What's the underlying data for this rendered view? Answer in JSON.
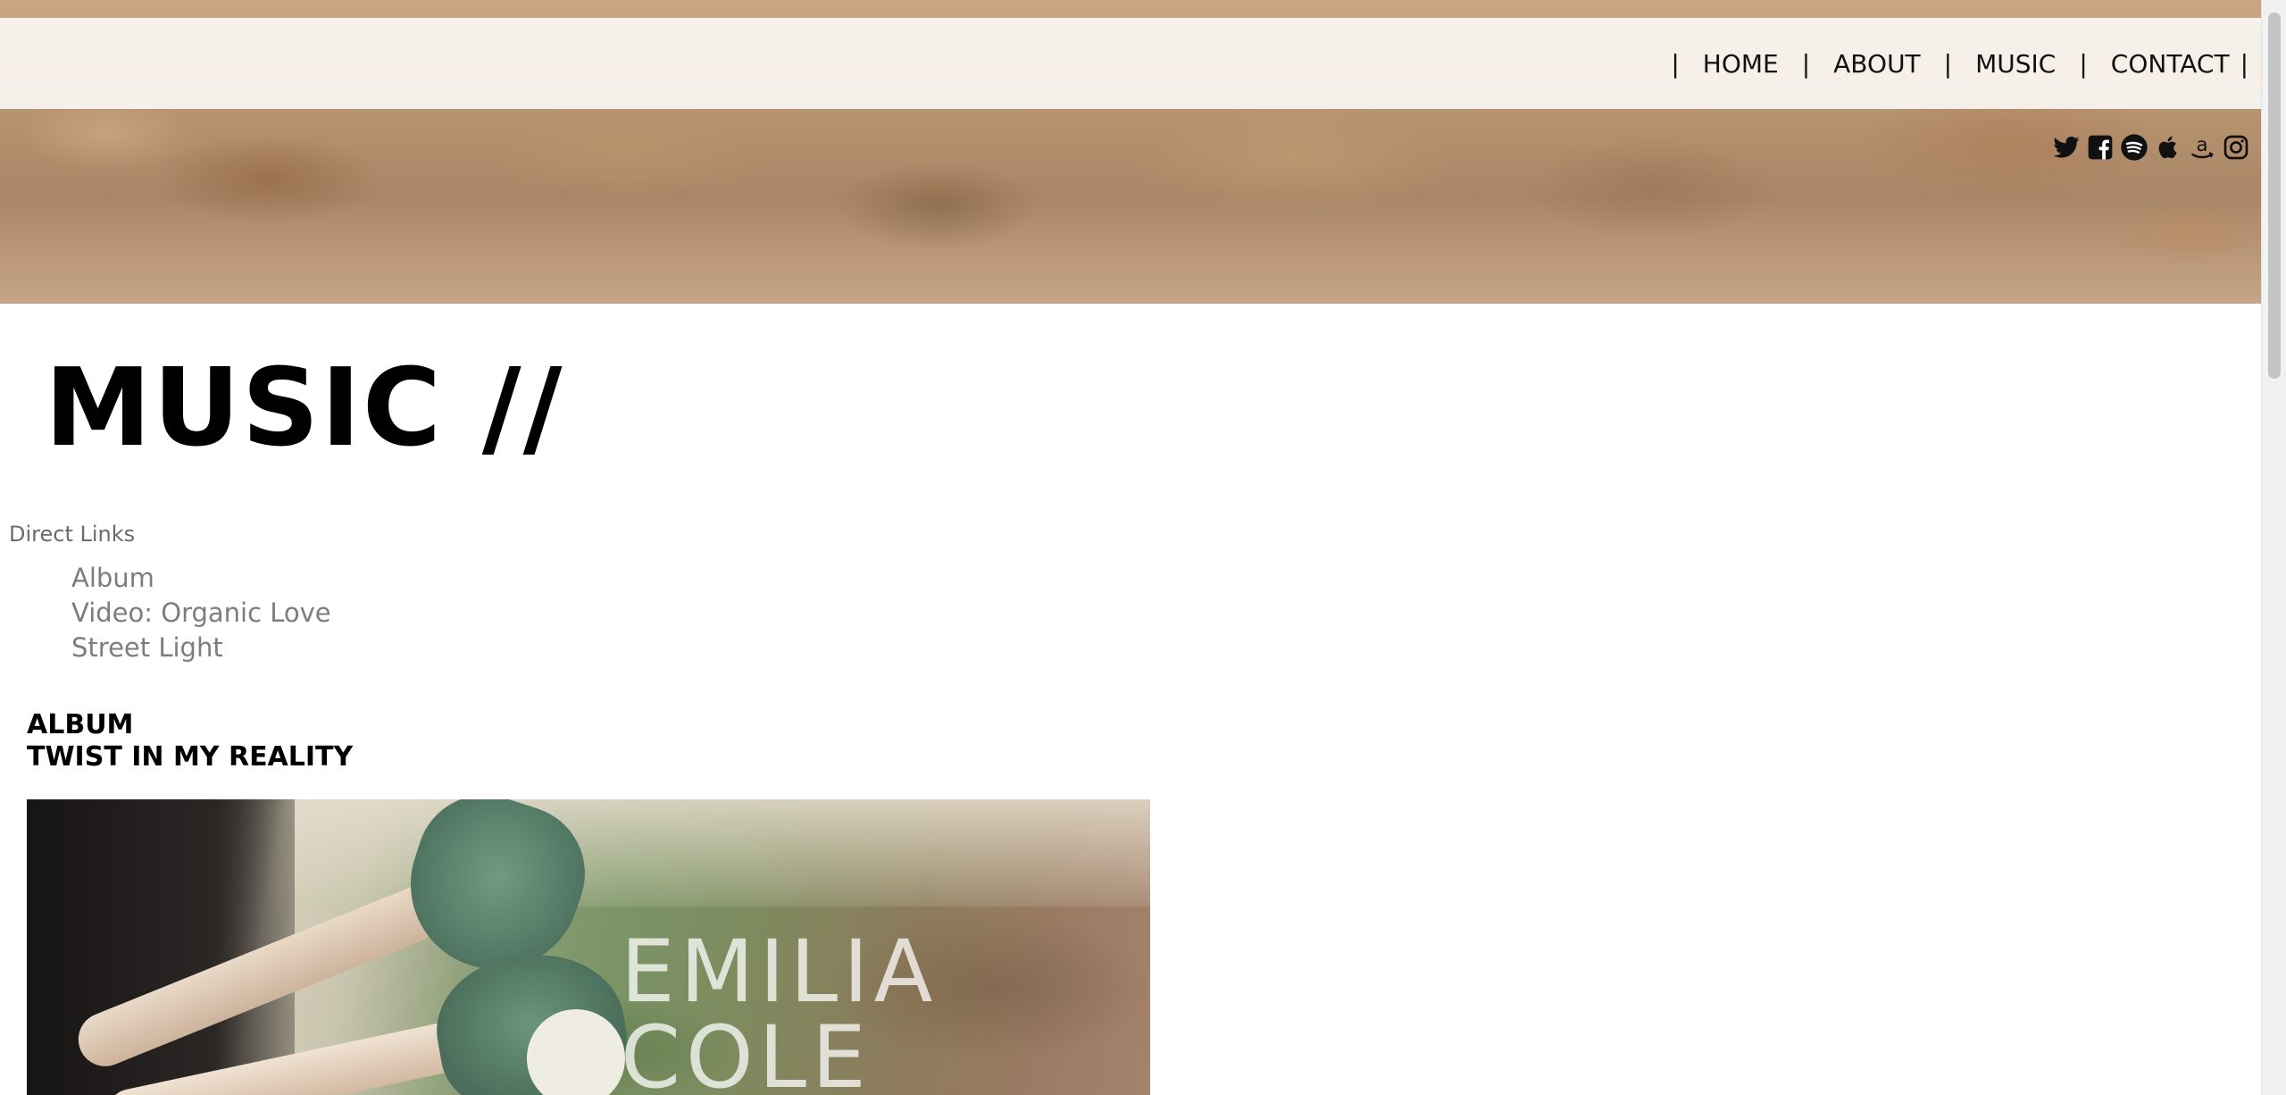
{
  "nav": {
    "items": [
      {
        "label": "HOME"
      },
      {
        "label": "ABOUT"
      },
      {
        "label": "MUSIC"
      },
      {
        "label": "CONTACT"
      }
    ],
    "separator": "|"
  },
  "social": [
    {
      "icon": "twitter-icon"
    },
    {
      "icon": "facebook-icon"
    },
    {
      "icon": "spotify-icon"
    },
    {
      "icon": "apple-icon"
    },
    {
      "icon": "amazon-icon"
    },
    {
      "icon": "instagram-icon"
    }
  ],
  "page": {
    "title": "MUSIC //"
  },
  "direct_links": {
    "title": "Direct Links",
    "items": [
      "Album",
      "Video: Organic Love",
      "Street Light"
    ]
  },
  "album": {
    "label": "ALBUM",
    "name": "TWIST IN MY REALITY",
    "art_text_line1": "EMILIA",
    "art_text_line2": "COLE"
  }
}
